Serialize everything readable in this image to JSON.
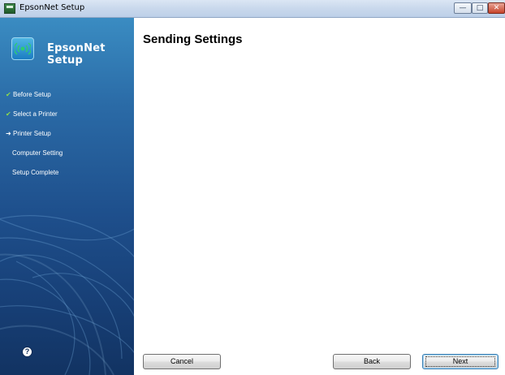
{
  "window": {
    "title": "EpsonNet Setup",
    "controls": {
      "minimize": "—",
      "maximize": "□",
      "close": "✕"
    }
  },
  "sidebar": {
    "brand": "EpsonNet Setup",
    "logo_icon": "wireless-printer-icon",
    "steps": [
      {
        "label": "Before Setup",
        "state": "done"
      },
      {
        "label": "Select a Printer",
        "state": "done"
      },
      {
        "label": "Printer Setup",
        "state": "current"
      },
      {
        "label": "Computer Setting",
        "state": "pending"
      },
      {
        "label": "Setup Complete",
        "state": "pending"
      }
    ],
    "help_label": "?"
  },
  "main": {
    "title": "Sending Settings"
  },
  "footer": {
    "cancel_label": "Cancel",
    "back_label": "Back",
    "next_label": "Next"
  },
  "colors": {
    "sidebar_top": "#3a8cc2",
    "sidebar_bottom": "#123362",
    "check": "#8fdc4a"
  }
}
